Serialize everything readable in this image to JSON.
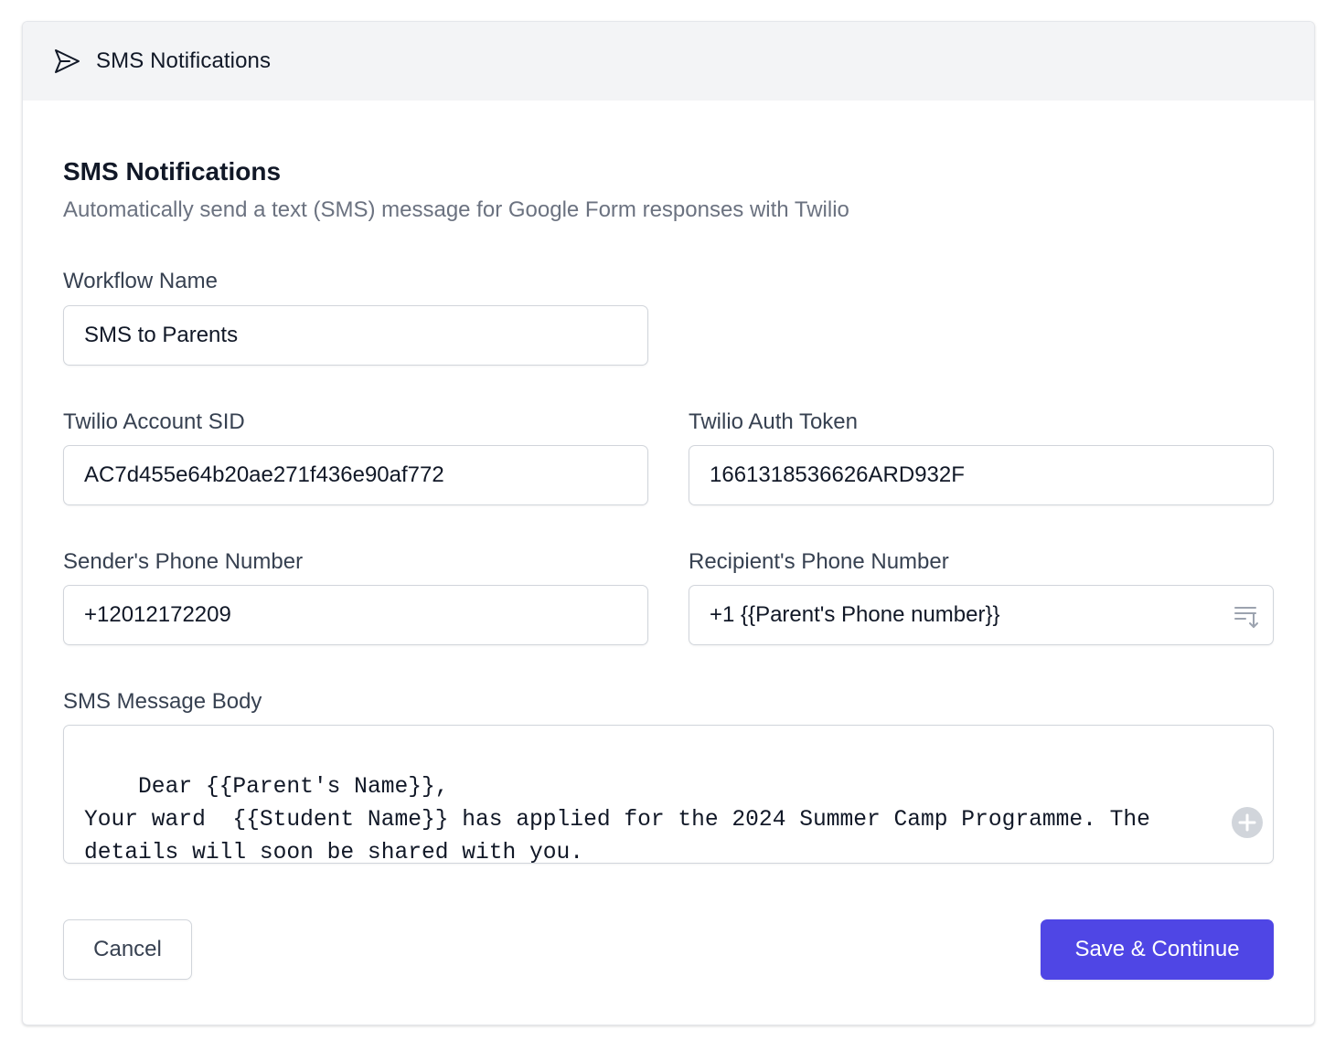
{
  "header": {
    "title": "SMS Notifications",
    "icon": "send-icon"
  },
  "section": {
    "title": "SMS Notifications",
    "subtitle": "Automatically send a text (SMS) message for Google Form responses with Twilio"
  },
  "fields": {
    "workflow_name": {
      "label": "Workflow Name",
      "value": "SMS to Parents"
    },
    "account_sid": {
      "label": "Twilio Account SID",
      "value": "AC7d455e64b20ae271f436e90af772"
    },
    "auth_token": {
      "label": "Twilio Auth Token",
      "value": "1661318536626ARD932F"
    },
    "sender_phone": {
      "label": "Sender's Phone Number",
      "value": "+12012172209"
    },
    "recipient_phone": {
      "label": "Recipient's Phone Number",
      "value": "+1 {{Parent's Phone number}}",
      "icon": "list-sort-icon"
    },
    "message_body": {
      "label": "SMS Message Body",
      "value": "Dear {{Parent's Name}},\nYour ward  {{Student Name}} has applied for the 2024 Summer Camp Programme. The details will soon be shared with you.",
      "icon": "plus-circle-icon"
    }
  },
  "actions": {
    "cancel_label": "Cancel",
    "save_label": "Save & Continue"
  },
  "colors": {
    "primary": "#4f46e5",
    "header_bg": "#f3f4f6",
    "border": "#d1d5db",
    "muted_text": "#6b7280"
  }
}
